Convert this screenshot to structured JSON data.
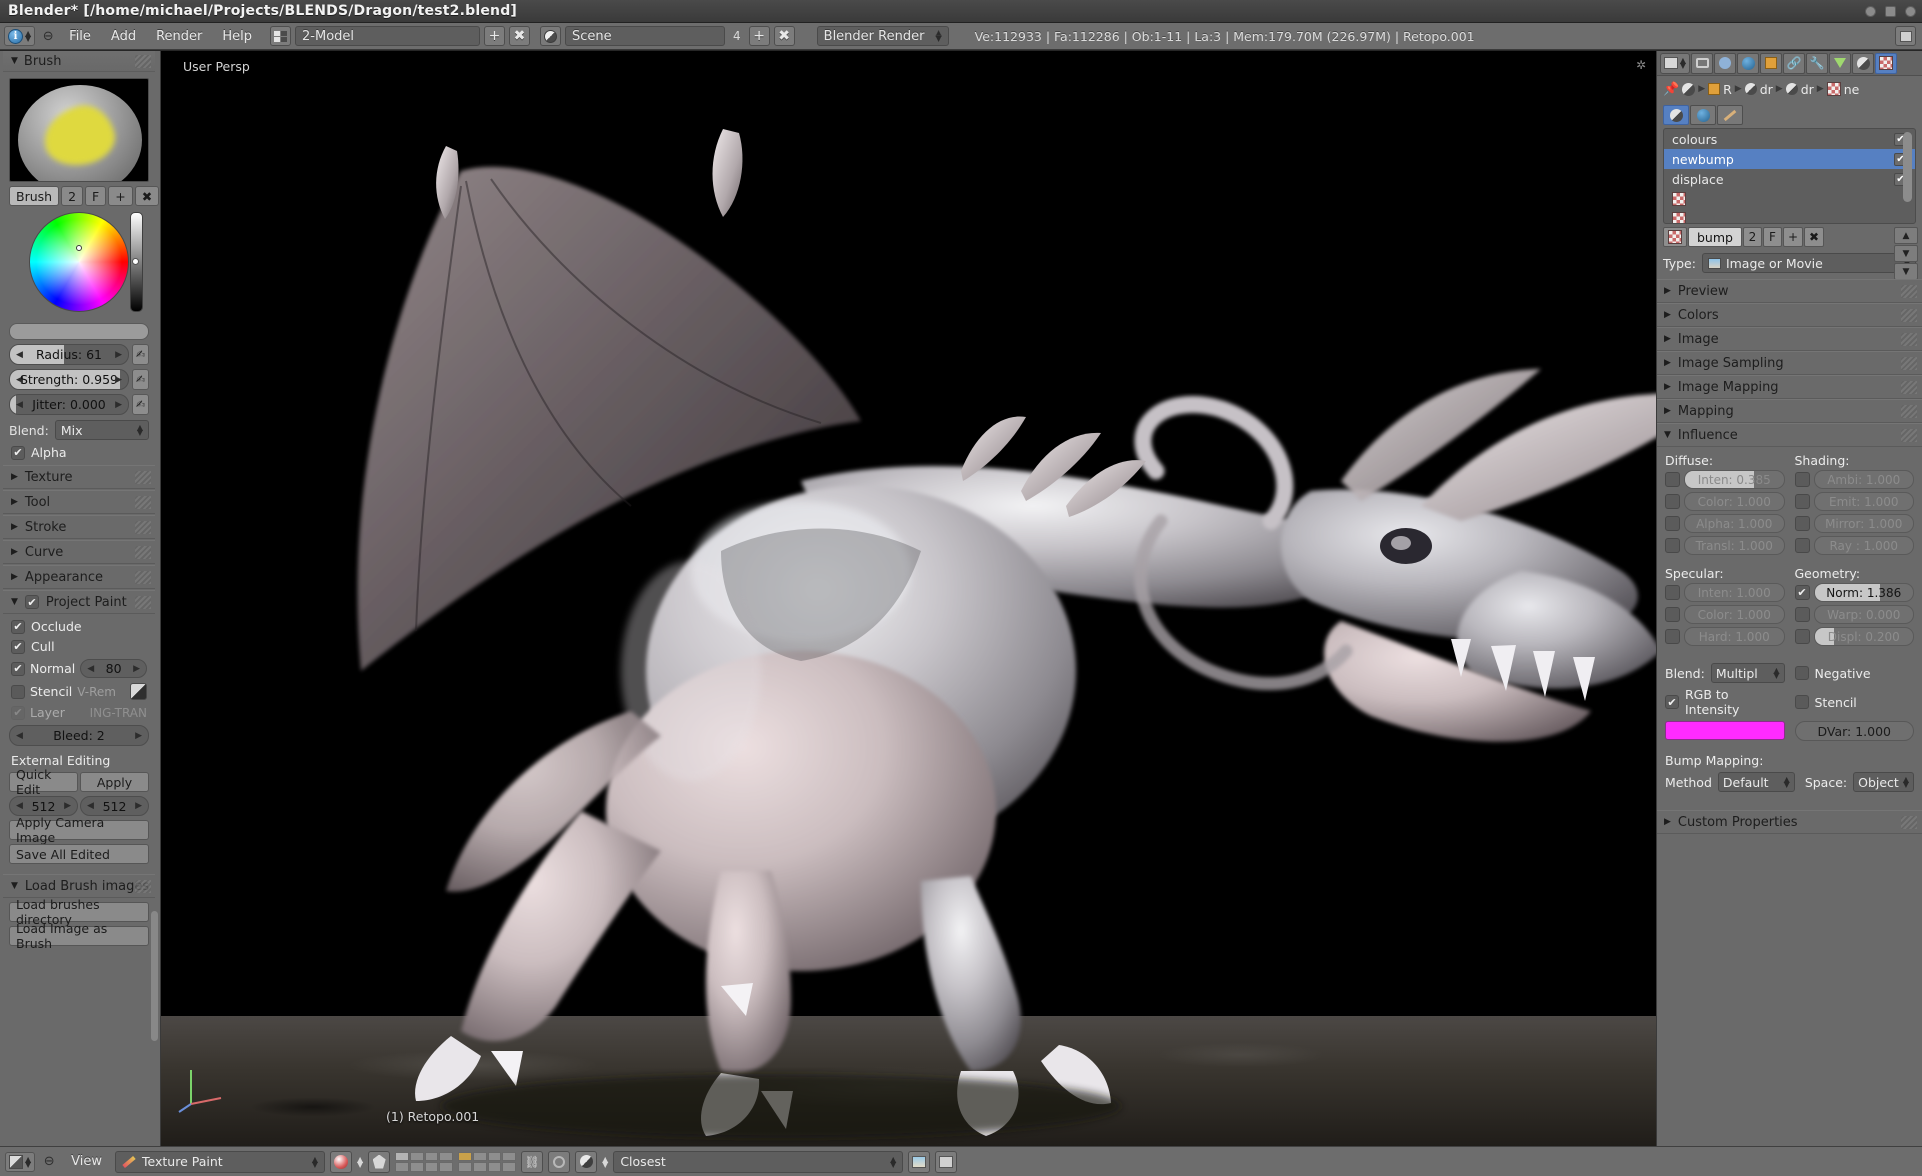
{
  "window": {
    "title": "Blender* [/home/michael/Projects/BLENDS/Dragon/test2.blend]",
    "buttons": [
      "minimize",
      "maximize",
      "close"
    ]
  },
  "topbar": {
    "info_icon": "info-icon",
    "collapse_label": "⊖",
    "menus": [
      "File",
      "Add",
      "Render",
      "Help"
    ],
    "screen_layout": {
      "icon": "screen-layout-icon",
      "value": "2-Model",
      "add_label": "+",
      "delete_label": "✖"
    },
    "scene": {
      "icon": "scene-icon",
      "value": "Scene",
      "count": "4",
      "add_label": "+",
      "delete_label": "✖"
    },
    "render_engine": "Blender Render",
    "stats": "Ve:112933 | Fa:112286 | Ob:1-11 | La:3 | Mem:179.70M (226.97M) | Retopo.001",
    "right_icon": "scripting-icon"
  },
  "viewport": {
    "view_label": "User Persp",
    "object_label": "(1) Retopo.001",
    "gear_icon": "viewport-gear-icon",
    "axis_widget": "axis-gizmo",
    "background_color": "#000000"
  },
  "left_panel": {
    "brush_panel": {
      "title": "Brush",
      "preview_icon": "brush-preview",
      "datablock": {
        "name": "Brush",
        "users": "2",
        "fake_user": "F",
        "add": "+",
        "unlink": "✖"
      },
      "color_wheel": "color-wheel",
      "value_slider": "value-slider",
      "color_strip": "color-strip",
      "sliders": [
        {
          "label": "Radius: 61",
          "fill": 0.46
        },
        {
          "label": "Strength: 0.959",
          "fill": 0.93
        },
        {
          "label": "Jitter: 0.000",
          "fill": 0.06
        }
      ],
      "blend": {
        "label": "Blend:",
        "value": "Mix"
      },
      "alpha": {
        "label": "Alpha",
        "checked": true
      }
    },
    "sections": [
      {
        "label": "Texture",
        "open": false
      },
      {
        "label": "Tool",
        "open": false
      },
      {
        "label": "Stroke",
        "open": false
      },
      {
        "label": "Curve",
        "open": false
      },
      {
        "label": "Appearance",
        "open": false
      }
    ],
    "project_paint": {
      "label": "Project Paint",
      "open": true,
      "checked": true,
      "occlude": {
        "label": "Occlude",
        "checked": true
      },
      "cull": {
        "label": "Cull",
        "checked": true
      },
      "normal": {
        "label": "Normal",
        "checked": true,
        "value": "80"
      },
      "stencil": {
        "label": "Stencil",
        "checked": false,
        "extra": "V-Rem"
      },
      "layer": {
        "label": "Layer",
        "checked": true,
        "dimmed": true,
        "extra": "ING-TRAN"
      },
      "bleed": {
        "label": "Bleed: 2"
      }
    },
    "external_editing": {
      "title": "External Editing",
      "quick_edit": "Quick Edit",
      "apply": "Apply",
      "width": "512",
      "height": "512",
      "apply_camera_image": "Apply Camera Image",
      "save_all_edited": "Save All Edited"
    },
    "load_brush_images": {
      "title": "Load Brush images",
      "open": true,
      "buttons": [
        "Load brushes directory",
        "Load Image as Brush"
      ]
    }
  },
  "right_panel": {
    "tabs": [
      "render-tab-icon",
      "scene-tab-icon",
      "world-tab-icon",
      "object-tab-icon",
      "constraints-tab-icon",
      "modifiers-tab-icon",
      "data-tab-icon",
      "material-tab-icon",
      "texture-tab-icon"
    ],
    "active_tab_index": 8,
    "breadcrumb": [
      {
        "icon": "pin-icon",
        "label": ""
      },
      {
        "icon": "brush-icon",
        "label": ""
      },
      {
        "icon": "object-icon",
        "label": "R"
      },
      {
        "icon": "material-icon",
        "label": "dr"
      },
      {
        "icon": "material-icon",
        "label": "dr"
      },
      {
        "icon": "texture-icon",
        "label": "ne"
      }
    ],
    "subtabs": [
      "material-context-icon",
      "world-context-icon",
      "brush-context-icon"
    ],
    "active_subtab_index": 0,
    "texture_slots": [
      {
        "name": "colours",
        "enabled": true,
        "selected": false
      },
      {
        "name": "newbump",
        "enabled": true,
        "selected": true
      },
      {
        "name": "displace",
        "enabled": true,
        "selected": false
      },
      {
        "name": "",
        "enabled": false,
        "selected": false,
        "icon": "checker-icon"
      },
      {
        "name": "",
        "enabled": false,
        "selected": false,
        "icon": "checker-icon"
      }
    ],
    "list_buttons": [
      "up-arrow-icon",
      "down-arrow-icon",
      "dropdown-icon"
    ],
    "texture_datablock": {
      "icon": "checker-icon",
      "name": "bump",
      "users": "2",
      "fake_user": "F",
      "add": "+",
      "unlink": "✖"
    },
    "type": {
      "label": "Type:",
      "value": "Image or Movie",
      "icon": "image-icon"
    },
    "accordions": [
      {
        "label": "Preview",
        "open": false
      },
      {
        "label": "Colors",
        "open": false
      },
      {
        "label": "Image",
        "open": false
      },
      {
        "label": "Image Sampling",
        "open": false
      },
      {
        "label": "Image Mapping",
        "open": false
      },
      {
        "label": "Mapping",
        "open": false
      },
      {
        "label": "Influence",
        "open": true
      }
    ],
    "influence": {
      "diffuse": {
        "title": "Diffuse:",
        "items": [
          {
            "label": "Inten: 0.385",
            "enabled": false,
            "fill": 0.7
          },
          {
            "label": "Color: 1.000",
            "enabled": false,
            "fill": 0
          },
          {
            "label": "Alpha: 1.000",
            "enabled": false,
            "fill": 0
          },
          {
            "label": "Transl: 1.000",
            "enabled": false,
            "fill": 0
          }
        ]
      },
      "shading": {
        "title": "Shading:",
        "items": [
          {
            "label": "Ambi: 1.000",
            "enabled": false,
            "fill": 0
          },
          {
            "label": "Emit: 1.000",
            "enabled": false,
            "fill": 0
          },
          {
            "label": "Mirror: 1.000",
            "enabled": false,
            "fill": 0
          },
          {
            "label": "Ray : 1.000",
            "enabled": false,
            "fill": 0
          }
        ]
      },
      "specular": {
        "title": "Specular:",
        "items": [
          {
            "label": "Inten: 1.000",
            "enabled": false,
            "fill": 0
          },
          {
            "label": "Color: 1.000",
            "enabled": false,
            "fill": 0
          },
          {
            "label": "Hard: 1.000",
            "enabled": false,
            "fill": 0
          }
        ]
      },
      "geometry": {
        "title": "Geometry:",
        "items": [
          {
            "label": "Norm: 1.386",
            "enabled": true,
            "fill": 0.66
          },
          {
            "label": "Warp: 0.000",
            "enabled": false,
            "fill": 0
          },
          {
            "label": "Displ: 0.200",
            "enabled": false,
            "fill": 0.2
          }
        ]
      },
      "blend": {
        "label": "Blend:",
        "value": "Multipl"
      },
      "negative": {
        "label": "Negative",
        "checked": false
      },
      "rgb_to_intensity": {
        "label": "RGB to Intensity",
        "checked": true
      },
      "stencil": {
        "label": "Stencil",
        "checked": false
      },
      "color_swatch": "#ff2bff",
      "dvar": "DVar: 1.000",
      "bump_mapping": {
        "title": "Bump Mapping:",
        "method_label": "Method",
        "method_value": "Default",
        "space_label": "Space:",
        "space_value": "Object"
      }
    },
    "custom_properties": {
      "label": "Custom Properties",
      "open": false
    }
  },
  "bottom_bar": {
    "editor_icon": "editor-type-icon",
    "collapse": "⊖",
    "view_menu": "View",
    "mode": {
      "icon": "texture-paint-icon",
      "value": "Texture Paint"
    },
    "shading_icon": "shading-mode-icon",
    "pivot_icon": "pivot-icon",
    "layers_icon": "scene-layers-icon",
    "snap_icon": "snap-magnet-icon",
    "interp_icon": "interpolation-icon",
    "interpolation": "Closest",
    "right_icons": [
      "render-image-icon",
      "render-animation-icon"
    ]
  },
  "colors": {
    "panel_bg": "#6a6a6a",
    "header_bg": "#6d6d6d",
    "accent_blue": "#5680c2",
    "viewport_bg": "#000000",
    "magenta": "#ff2bff",
    "brush_yellow": "#dfd93f"
  }
}
